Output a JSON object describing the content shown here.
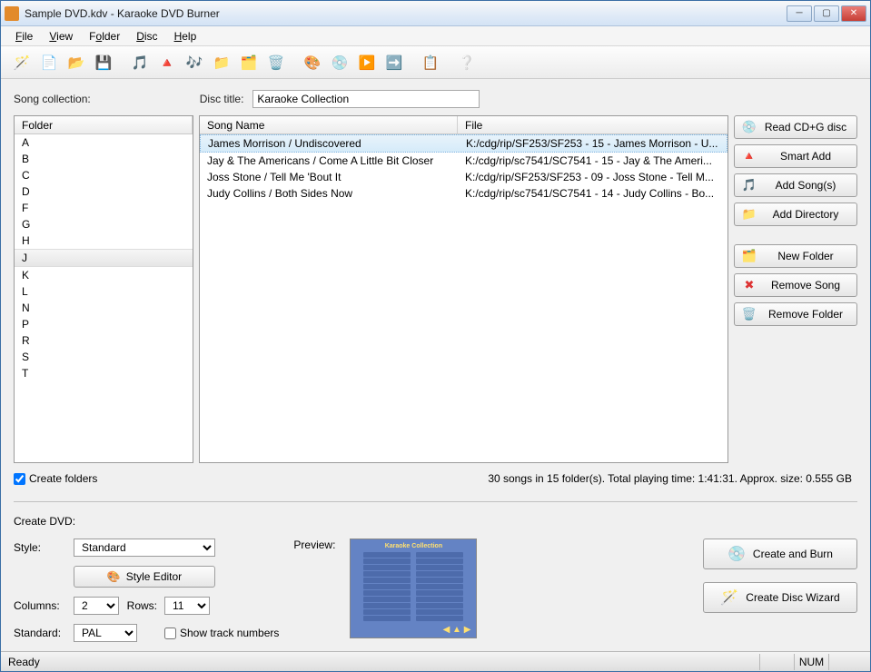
{
  "window": {
    "title": "Sample DVD.kdv - Karaoke DVD Burner"
  },
  "menu": {
    "file": "File",
    "view": "View",
    "folder": "Folder",
    "disc": "Disc",
    "help": "Help"
  },
  "labels": {
    "song_collection": "Song collection:",
    "disc_title": "Disc title:",
    "folder_header": "Folder",
    "song_name_header": "Song Name",
    "file_header": "File",
    "create_folders": "Create folders",
    "create_dvd": "Create DVD:",
    "style": "Style:",
    "preview": "Preview:",
    "columns": "Columns:",
    "rows": "Rows:",
    "standard": "Standard:",
    "show_track_numbers": "Show track numbers"
  },
  "disc_title_value": "Karaoke Collection",
  "folders": [
    "A",
    "B",
    "C",
    "D",
    "F",
    "G",
    "H",
    "J",
    "K",
    "L",
    "N",
    "P",
    "R",
    "S",
    "T"
  ],
  "selected_folder": "J",
  "songs": [
    {
      "name": "James Morrison / Undiscovered",
      "file": "K:/cdg/rip/SF253/SF253 - 15 - James Morrison - U..."
    },
    {
      "name": "Jay & The Americans / Come A Little Bit Closer",
      "file": "K:/cdg/rip/sc7541/SC7541 - 15 - Jay & The Ameri..."
    },
    {
      "name": "Joss Stone / Tell Me 'Bout It",
      "file": "K:/cdg/rip/SF253/SF253 - 09 - Joss Stone - Tell M..."
    },
    {
      "name": "Judy Collins / Both Sides Now",
      "file": "K:/cdg/rip/sc7541/SC7541 - 14 - Judy Collins - Bo..."
    }
  ],
  "selected_song_index": 0,
  "summary": "30 songs in 15 folder(s). Total playing time: 1:41:31. Approx. size: 0.555 GB",
  "side_buttons": {
    "read_cdg": "Read CD+G disc",
    "smart_add": "Smart Add",
    "add_songs": "Add Song(s)",
    "add_directory": "Add Directory",
    "new_folder": "New Folder",
    "remove_song": "Remove Song",
    "remove_folder": "Remove Folder"
  },
  "style_value": "Standard",
  "style_editor": "Style Editor",
  "columns_value": "2",
  "rows_value": "11",
  "standard_value": "PAL",
  "big_buttons": {
    "create_burn": "Create and Burn",
    "wizard": "Create Disc Wizard"
  },
  "preview_title": "Karaoke Collection",
  "status": {
    "ready": "Ready",
    "num": "NUM"
  }
}
